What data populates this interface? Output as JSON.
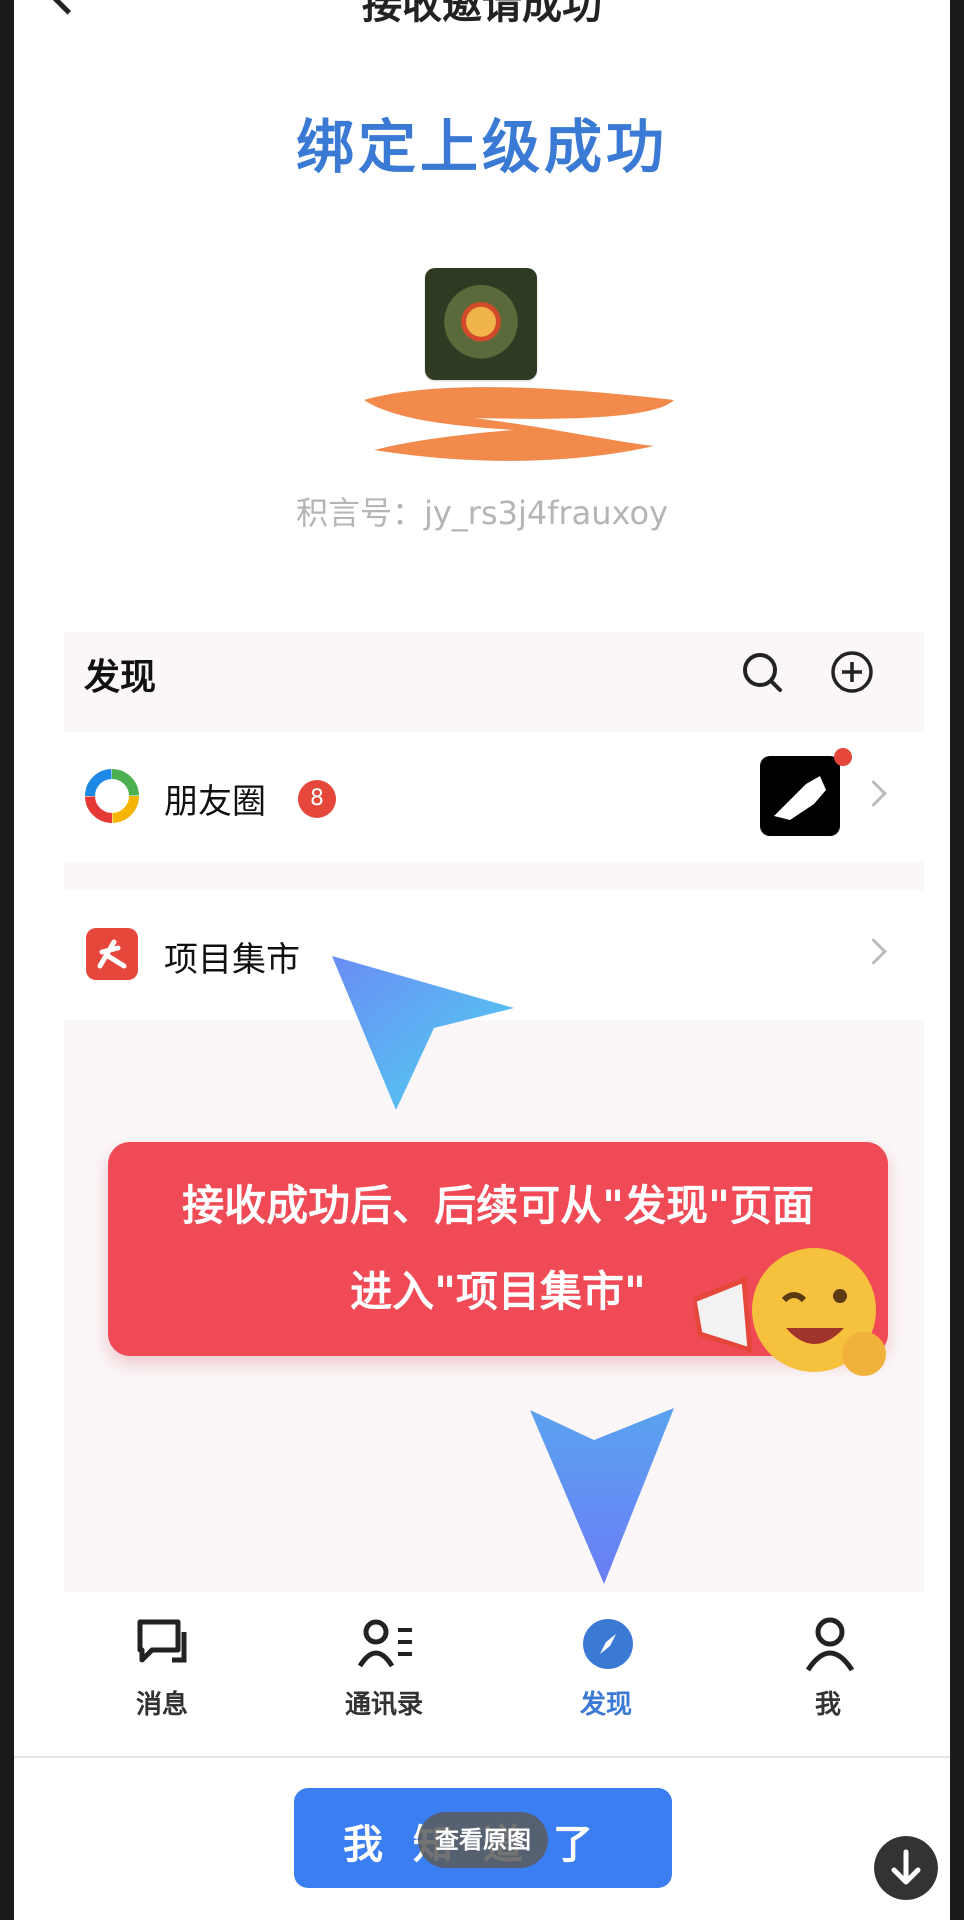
{
  "header": {
    "title": "接收邀请成功"
  },
  "headline": "绑定上级成功",
  "profile": {
    "jy_id": "积言号：jy_rs3j4frauxoy"
  },
  "discover": {
    "title": "发现",
    "items": [
      {
        "label": "朋友圈",
        "badge": "8"
      },
      {
        "label": "项目集市"
      }
    ]
  },
  "tip": {
    "line1": "接收成功后、后续可从\"发现\"页面",
    "line2": "进入\"项目集市\""
  },
  "tabs": [
    {
      "label": "消息"
    },
    {
      "label": "通讯录"
    },
    {
      "label": "发现"
    },
    {
      "label": "我"
    }
  ],
  "confirm_button": {
    "label": "我知道了"
  },
  "overlay": {
    "view_original": "查看原图"
  },
  "colors": {
    "accent": "#3a7ad4",
    "tip_bg": "#ef4a55",
    "button": "#3b7ef2",
    "badge": "#e5473b"
  }
}
